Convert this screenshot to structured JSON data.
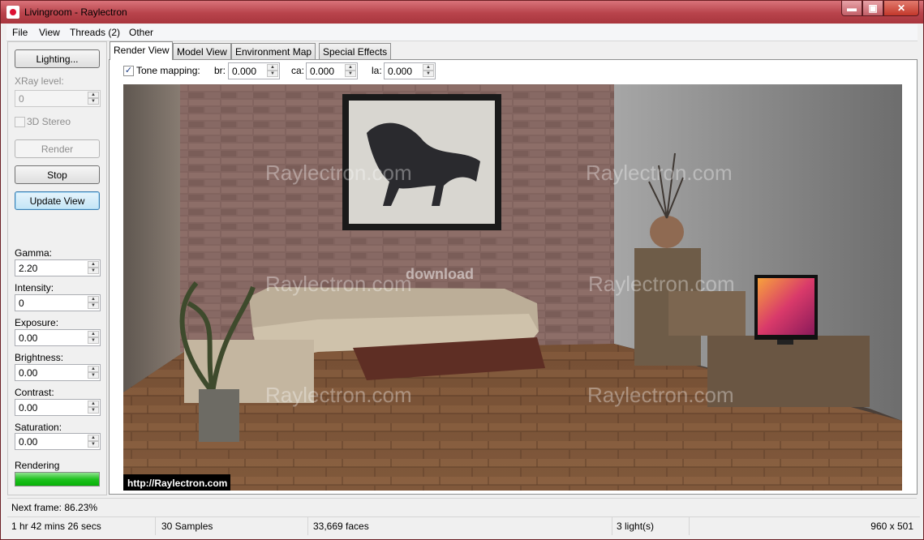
{
  "window": {
    "title": "Livingroom - Raylectron"
  },
  "caption_buttons": {
    "minimize": "▬",
    "maximize": "▣",
    "close": "✕"
  },
  "menu": [
    "File",
    "View",
    "Threads (2)",
    "Other"
  ],
  "left_panel": {
    "lighting_button": "Lighting...",
    "xray_label": "XRay level:",
    "xray_value": "0",
    "stereo_label": "3D Stereo",
    "render_button": "Render",
    "stop_button": "Stop",
    "update_button": "Update View",
    "fields": [
      {
        "label": "Gamma:",
        "value": "2.20"
      },
      {
        "label": "Intensity:",
        "value": "0"
      },
      {
        "label": "Exposure:",
        "value": "0.00"
      },
      {
        "label": "Brightness:",
        "value": "0.00"
      },
      {
        "label": "Contrast:",
        "value": "0.00"
      },
      {
        "label": "Saturation:",
        "value": "0.00"
      }
    ],
    "rendering_label": "Rendering",
    "rendering_progress": 1.0
  },
  "tabs": [
    "Render View",
    "Model View",
    "Environment Map",
    "Special Effects"
  ],
  "tone_mapping": {
    "label": "Tone mapping:",
    "checked": true,
    "check_glyph": "✓",
    "br_label": "br:",
    "br_value": "0.000",
    "ca_label": "ca:",
    "ca_value": "0.000",
    "la_label": "la:",
    "la_value": "0.000"
  },
  "render_image": {
    "watermarks": [
      "Raylectron.com",
      "Raylectron.com",
      "Raylectron.com",
      "Raylectron.com",
      "Raylectron.com",
      "Raylectron.com"
    ],
    "url_caption": "http://Raylectron.com",
    "site_badge": "download"
  },
  "status": {
    "next_frame": "Next frame: 86.23%",
    "elapsed": "1 hr  42 mins  26 secs",
    "samples": "30 Samples",
    "faces": "33,669 faces",
    "lights": "3 light(s)",
    "resolution": "960 x 501"
  },
  "colors": {
    "title_bar": "#b8434b",
    "progress": "#1fc21f",
    "focus": "#3c7fb1"
  }
}
